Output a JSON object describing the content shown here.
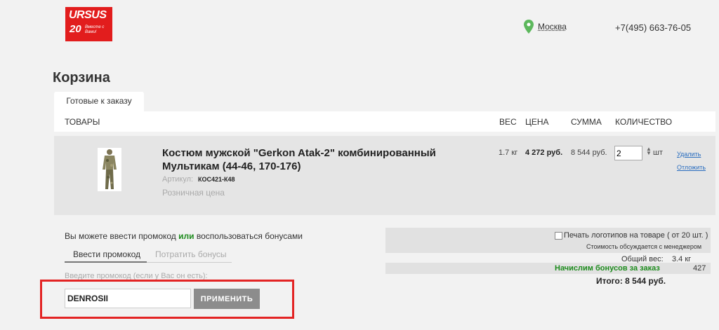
{
  "header": {
    "logo_text": "URSUS",
    "logo_years": "20",
    "logo_slogan": "Вместе с Вами!",
    "city": "Москва",
    "phone": "+7(495) 663-76-05"
  },
  "page_title": "Корзина",
  "tab_label": "Готовые к заказу",
  "table_headers": {
    "items": "ТОВАРЫ",
    "weight": "ВЕС",
    "price": "ЦЕНА",
    "sum": "СУММА",
    "qty": "КОЛИЧЕСТВО"
  },
  "product": {
    "name": "Костюм мужской \"Gerkon Atak-2\" комбинированный Мультикам (44-46, 170-176)",
    "sku_label": "Артикул:",
    "sku": "КОС421-К48",
    "price_type": "Розничная цена",
    "weight": "1.7 кг",
    "price": "4 272 руб.",
    "sum": "8 544 руб.",
    "qty": "2",
    "unit": "шт",
    "delete": "Удалить",
    "postpone": "Отложить"
  },
  "promo": {
    "hint_pre": "Вы можете ввести промокод",
    "hint_or": "или",
    "hint_post": "воспользоваться бонусами",
    "tab_enter": "Ввести промокод",
    "tab_bonus": "Потратить бонусы",
    "label": "Введите промокод (если у Вас он есть):",
    "value": "DENROSII",
    "apply": "ПРИМЕНИТЬ"
  },
  "summary": {
    "logo_print": "Печать логотипов на товаре ( от 20 шт. )",
    "logo_note": "Стоимость обсуждается с менеджером",
    "weight_label": "Общий вес:",
    "weight_value": "3.4 кг",
    "bonus_label": "Начислим бонусов за заказ",
    "bonus_value": "427",
    "total": "Итого: 8 544 руб."
  },
  "colors": {
    "brand": "#e21d1d",
    "bonus_green": "#1d8b1d",
    "link": "#2a6dbf",
    "highlight": "#e32424"
  }
}
